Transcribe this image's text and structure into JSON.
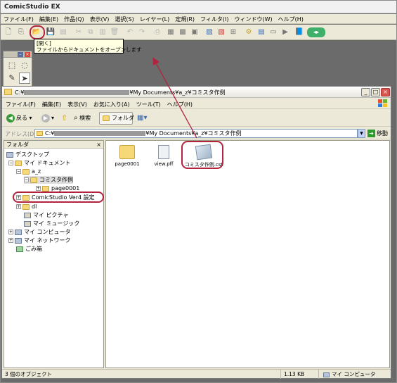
{
  "comicstudio": {
    "title": "ComicStudio EX",
    "menu": [
      "ファイル(F)",
      "編集(E)",
      "作品(Q)",
      "表示(V)",
      "選択(S)",
      "レイヤー(L)",
      "定規(R)",
      "フィルタ(I)",
      "ウィンドウ(W)",
      "ヘルプ(H)"
    ],
    "tooltip": {
      "line1": "[開く]",
      "line2": "ファイルからドキュメントをオープンします"
    },
    "accent": "#b2233d"
  },
  "explorer": {
    "title_prefix": "C:¥",
    "title_suffix": "¥My Documents¥a_z¥コミスタ作例",
    "menu": [
      "ファイル(F)",
      "編集(E)",
      "表示(V)",
      "お気に入り(A)",
      "ツール(T)",
      "ヘルプ(H)"
    ],
    "toolbar": {
      "back": "戻る",
      "search": "検索",
      "folders": "フォルダ"
    },
    "address": {
      "label": "アドレス(D)",
      "prefix": "C:¥",
      "suffix": "¥My Documents¥a_z¥コミスタ作例",
      "go": "移動"
    },
    "folder_pane": {
      "header": "フォルダ",
      "close": "×",
      "items": [
        "デスクトップ",
        "マイ ドキュメント",
        "a_z",
        "コミスタ作例",
        "page0001",
        "ComicStudio Ver4 設定",
        "dl",
        "マイ ピクチャ",
        "マイ ミュージック",
        "マイ コンピュータ",
        "マイ ネットワーク",
        "ごみ箱"
      ]
    },
    "files": [
      "page0001",
      "view.pff",
      "コミスタ作例.cst"
    ],
    "status": {
      "count": "3 個のオブジェクト",
      "size": "1.13 KB",
      "location": "マイ コンピュータ"
    }
  }
}
